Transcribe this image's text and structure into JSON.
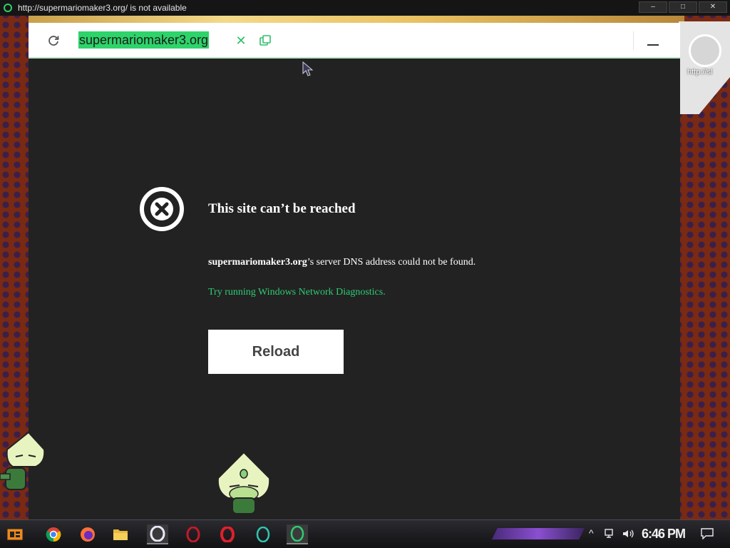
{
  "window": {
    "title": "http://supermariomaker3.org/ is not available",
    "controls": [
      "–",
      "□",
      "✕"
    ]
  },
  "toolbar": {
    "url_text": "supermariomaker3.org",
    "clear_label": "✕"
  },
  "error": {
    "title": "This site can’t be reached",
    "domain": "supermariomaker3.org",
    "desc_suffix": "’s server DNS address could not be found.",
    "diag_prefix": "Try running ",
    "diag_link": "Windows Network Diagnostics",
    "diag_suffix": ".",
    "reload_label": "Reload"
  },
  "side_panel": {
    "url": "http://sl"
  },
  "taskbar": {
    "clock": "6:46 PM",
    "apps": [
      "start-icon",
      "chrome-icon",
      "firefox-icon",
      "file-explorer-icon",
      "opera-icon",
      "opera-red-icon",
      "opera-icon",
      "opera-gx-icon",
      "opera-green-icon"
    ]
  },
  "colors": {
    "accent_green": "#2ecb73",
    "url_highlight": "#2ed36a",
    "page_background": "#222222",
    "toolbar_background": "#ffffff"
  }
}
